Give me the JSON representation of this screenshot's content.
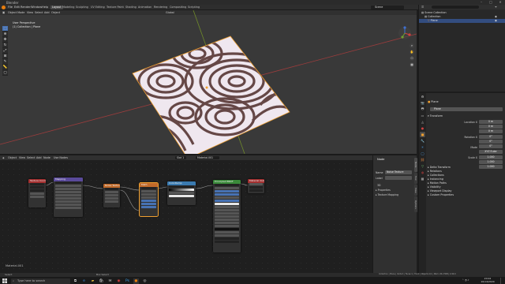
{
  "window": {
    "title": "Blender"
  },
  "menubar": {
    "items": [
      "File",
      "Edit",
      "Render",
      "Window",
      "Help"
    ],
    "workspaces": [
      "Layout",
      "Modeling",
      "Sculpting",
      "UV Editing",
      "Texture Paint",
      "Shading",
      "Animation",
      "Rendering",
      "Compositing",
      "Scripting"
    ],
    "active_workspace": "Layout",
    "scene": "Scene",
    "view_layer": "ViewLayer"
  },
  "viewport": {
    "header": [
      "Object Mode",
      "View",
      "Select",
      "Add",
      "Object"
    ],
    "orientation": "Global",
    "info_line1": "User Perspective",
    "info_line2": "(1) Collection | Plane",
    "tools": [
      "select-box-icon",
      "cursor-icon",
      "move-icon",
      "rotate-icon",
      "scale-icon",
      "transform-icon",
      "annotate-icon",
      "measure-icon",
      "add-cube-icon"
    ],
    "colors": {
      "grid_x": "#9b3c3c",
      "grid_y": "#6f8a2a",
      "plane_light": "#efe7ef",
      "plane_dark": "#5a3a38",
      "selection": "#f0a030"
    }
  },
  "node_editor": {
    "header": [
      "Object",
      "View",
      "Select",
      "Add",
      "Node"
    ],
    "use_nodes": "Use Nodes",
    "slot": "Slot 1",
    "material": "Material.001",
    "footer_label": "Material.001",
    "nodes": [
      {
        "label": "Texture Coordinate",
        "head_color": "#a43030"
      },
      {
        "label": "Mapping",
        "head_color": "#5a4a9a"
      },
      {
        "label": "Noise Texture",
        "head_color": "#c06a2a"
      },
      {
        "label": "Math",
        "head_color": "#c06a2a"
      },
      {
        "label": "ColorRamp",
        "head_color": "#3a7ab0"
      },
      {
        "label": "Principled BSDF",
        "head_color": "#3a8a3a"
      },
      {
        "label": "Material Output",
        "head_color": "#a43030"
      }
    ]
  },
  "node_sidebar": {
    "title": "Node",
    "name_label": "Name",
    "name_value": "Noise Texture",
    "label_label": "Label",
    "sections": [
      "Properties",
      "Texture Mapping"
    ],
    "dimension": "3D",
    "tabs": [
      "Node",
      "Tool",
      "View",
      "Options"
    ]
  },
  "outliner": {
    "search_placeholder": "",
    "rows": [
      "Scene Collection",
      "Collection",
      "Plane"
    ]
  },
  "properties": {
    "object_name": "Plane",
    "panel_transform": "Transform",
    "location_label": "Location X",
    "rotation_label": "Rotation X",
    "scale_label": "Scale X",
    "mode_label": "Mode",
    "mode_value": "XYZ Euler",
    "location": [
      "0 m",
      "0 m",
      "0 m"
    ],
    "rotation": [
      "0°",
      "0°",
      "0°"
    ],
    "scale": [
      "1.000",
      "1.000",
      "1.000"
    ],
    "panels": [
      "Delta Transform",
      "Relations",
      "Collections",
      "Instancing",
      "Motion Paths",
      "Visibility",
      "Viewport Display",
      "Custom Properties"
    ]
  },
  "statusbar": {
    "left": "Select",
    "middle": "Box Select",
    "right": "Collection | Plane | Verts:4 | Faces:1 | Tris:2 | Objects:1/1 | Mem: 26.2 MiB | 2.90.0"
  },
  "taskbar": {
    "search_placeholder": "Type here to search",
    "time": "20:02",
    "date": "10/14/2020",
    "app_icons": [
      "task-view-icon",
      "edge-icon",
      "explorer-icon",
      "store-icon",
      "mail-icon",
      "chrome-icon",
      "photoshop-icon",
      "blender-icon",
      "obs-icon"
    ]
  }
}
